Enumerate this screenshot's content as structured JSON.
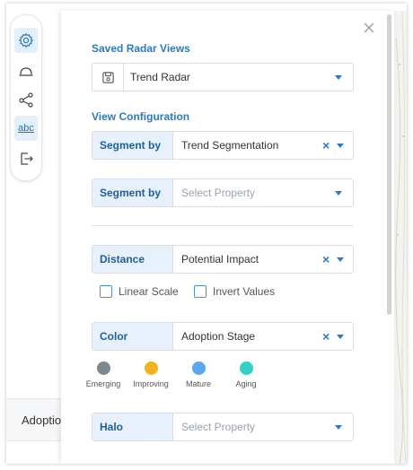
{
  "toolbar": {
    "items": [
      {
        "icon": "gear-icon",
        "active": true
      },
      {
        "icon": "dome-icon",
        "active": false
      },
      {
        "icon": "share-nodes-icon",
        "active": false
      },
      {
        "icon": "abc-text-icon",
        "label": "abc",
        "active": true
      },
      {
        "icon": "export-icon",
        "active": false
      }
    ]
  },
  "side_tab": {
    "label": "Adoptio"
  },
  "panel": {
    "saved_views_title": "Saved Radar Views",
    "saved_view": {
      "value": "Trend Radar",
      "icon": "save-disk-icon"
    },
    "view_config_title": "View Configuration",
    "segment1": {
      "label": "Segment by",
      "value": "Trend Segmentation"
    },
    "segment2": {
      "label": "Segment by",
      "placeholder": "Select Property"
    },
    "distance": {
      "label": "Distance",
      "value": "Potential Impact"
    },
    "linear_scale": {
      "label": "Linear Scale",
      "checked": false
    },
    "invert_values": {
      "label": "Invert Values",
      "checked": false
    },
    "color": {
      "label": "Color",
      "value": "Adoption Stage"
    },
    "legend": [
      {
        "label": "Emerging",
        "color": "#7d8891"
      },
      {
        "label": "Improving",
        "color": "#f2b31b"
      },
      {
        "label": "Mature",
        "color": "#5aa8f0"
      },
      {
        "label": "Aging",
        "color": "#2fd1c9"
      }
    ],
    "halo": {
      "label": "Halo",
      "placeholder": "Select Property"
    },
    "clear_symbol": "×"
  },
  "colors": {
    "accent": "#2b7bc4",
    "label_bg": "#e6f1fb"
  }
}
